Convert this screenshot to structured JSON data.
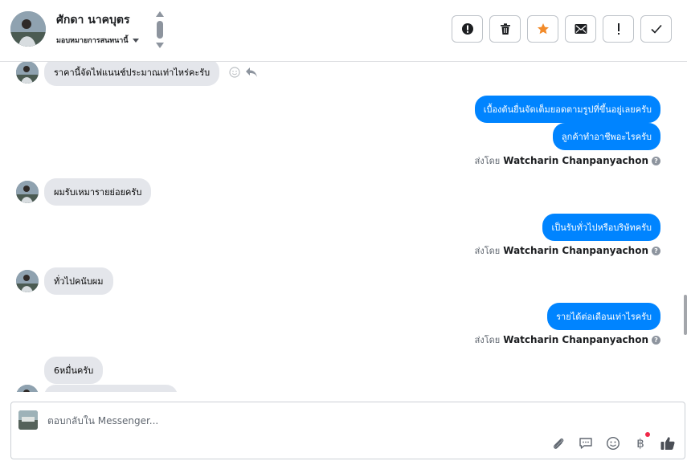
{
  "header": {
    "contact_name": "ศักดา นาคบุตร",
    "assign_label": "มอบหมายการสนทนานี้",
    "actions": [
      {
        "name": "spam-button",
        "icon": "exclamation-circle-icon"
      },
      {
        "name": "delete-button",
        "icon": "trash-icon"
      },
      {
        "name": "star-button",
        "icon": "star-icon"
      },
      {
        "name": "mark-unread-button",
        "icon": "envelope-icon"
      },
      {
        "name": "follow-up-button",
        "icon": "exclamation-icon"
      },
      {
        "name": "mark-done-button",
        "icon": "checkmark-icon"
      }
    ]
  },
  "messages": {
    "m1": "ราคานี้จัดไฟแนนช์ประมาณเท่าไหร่คะรับ",
    "m2": "เบื้องต้นยื่นจัดเต็มยอดตามรูปที่ขึ้นอยู่เลยครับ",
    "m3": "ลูกค้าทำอาชีพอะไรครับ",
    "m4": "ผมรับเหมารายย่อยครับ",
    "m5": "เป็นรับทั่วไปหรือบริษัทครับ",
    "m6": "ทั่วไปคนับผม",
    "m7": "รายได้ต่อเดือนเท่าไรครับ",
    "m8": "6หมื่นครับ"
  },
  "sent_by": {
    "prefix": "ส่งโดย",
    "agent": "Watcharin Chanpanyachon"
  },
  "composer": {
    "placeholder": "ตอบกลับใน Messenger...",
    "tools": [
      "attachment-icon",
      "saved-reply-icon",
      "emoji-icon",
      "baht-icon",
      "like-icon"
    ],
    "baht_symbol": "฿"
  },
  "colors": {
    "outgoing": "#0084ff",
    "incoming": "#e4e6eb",
    "star": "#f28b2a"
  }
}
